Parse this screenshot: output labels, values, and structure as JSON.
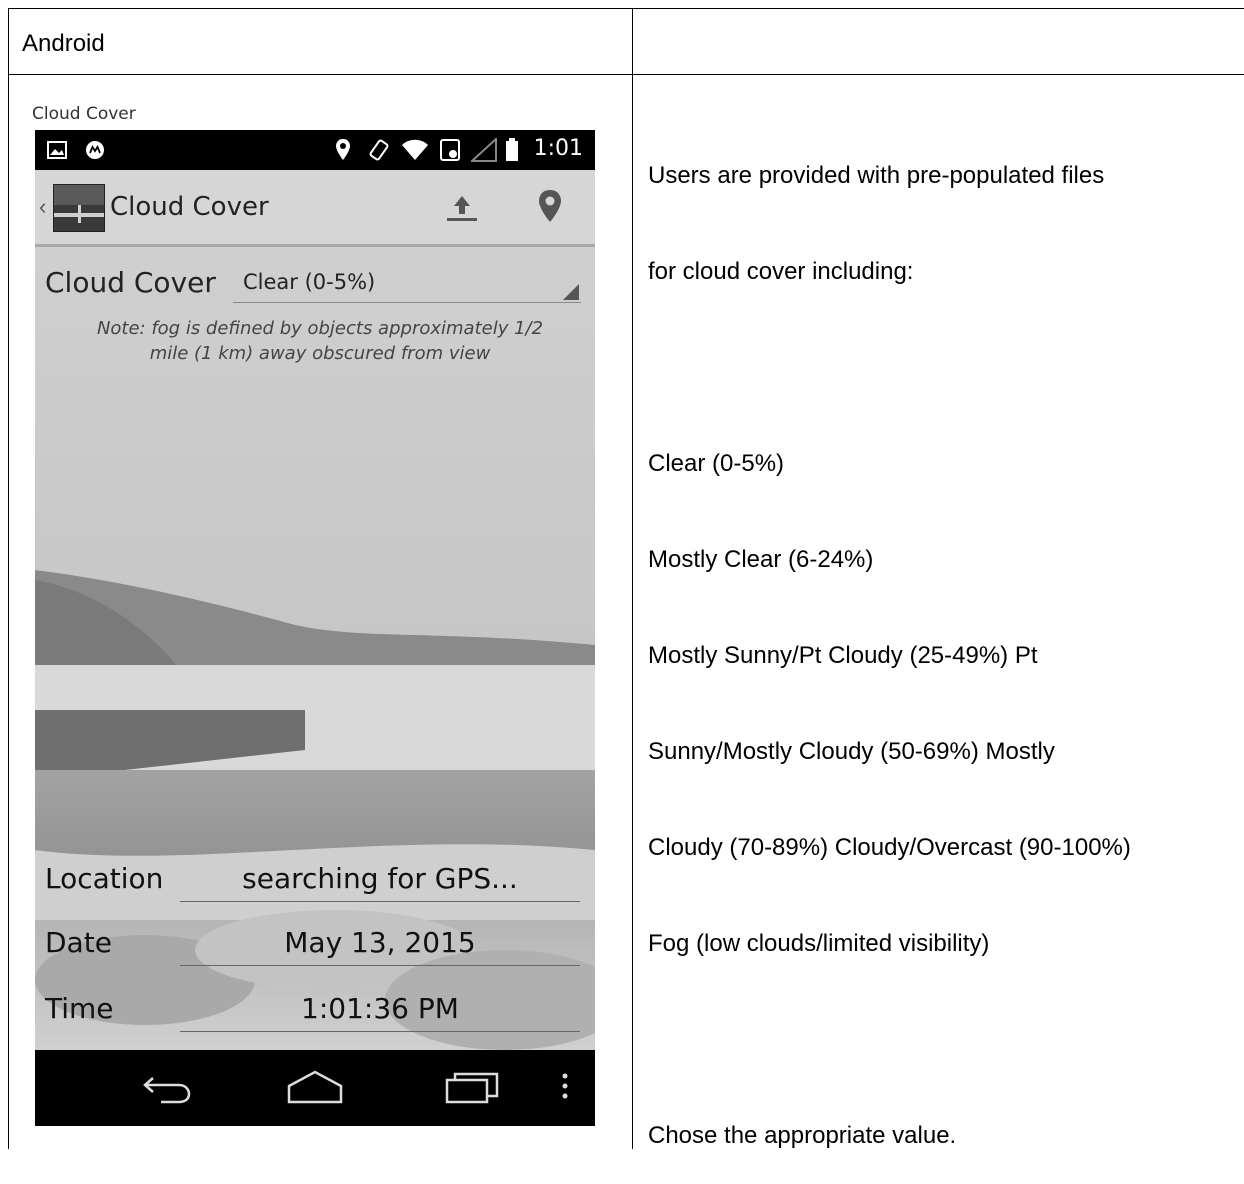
{
  "table": {
    "header_left": "Android",
    "header_right": "",
    "description_lines": [
      "Users are provided with pre-populated files",
      "for cloud cover including:",
      "",
      "Clear (0-5%)",
      "Mostly Clear (6-24%)",
      "Mostly Sunny/Pt Cloudy (25-49%) Pt",
      "Sunny/Mostly Cloudy (50-69%) Mostly",
      "Cloudy (70-89%) Cloudy/Overcast (90-100%)",
      "Fog (low clouds/limited visibility)",
      "",
      "Chose the appropriate value."
    ]
  },
  "screenshot": {
    "caption": "Cloud Cover",
    "status_time": "1:01",
    "app_title": "Cloud Cover",
    "cloud_cover_label": "Cloud Cover",
    "cloud_cover_value": "Clear (0-5%)",
    "note": "Note: fog is defined by objects approximately 1/2 mile (1 km) away obscured from view",
    "location_label": "Location",
    "location_value": "searching for GPS...",
    "date_label": "Date",
    "date_value": "May 13, 2015",
    "time_label": "Time",
    "time_value": "1:01:36 PM"
  }
}
